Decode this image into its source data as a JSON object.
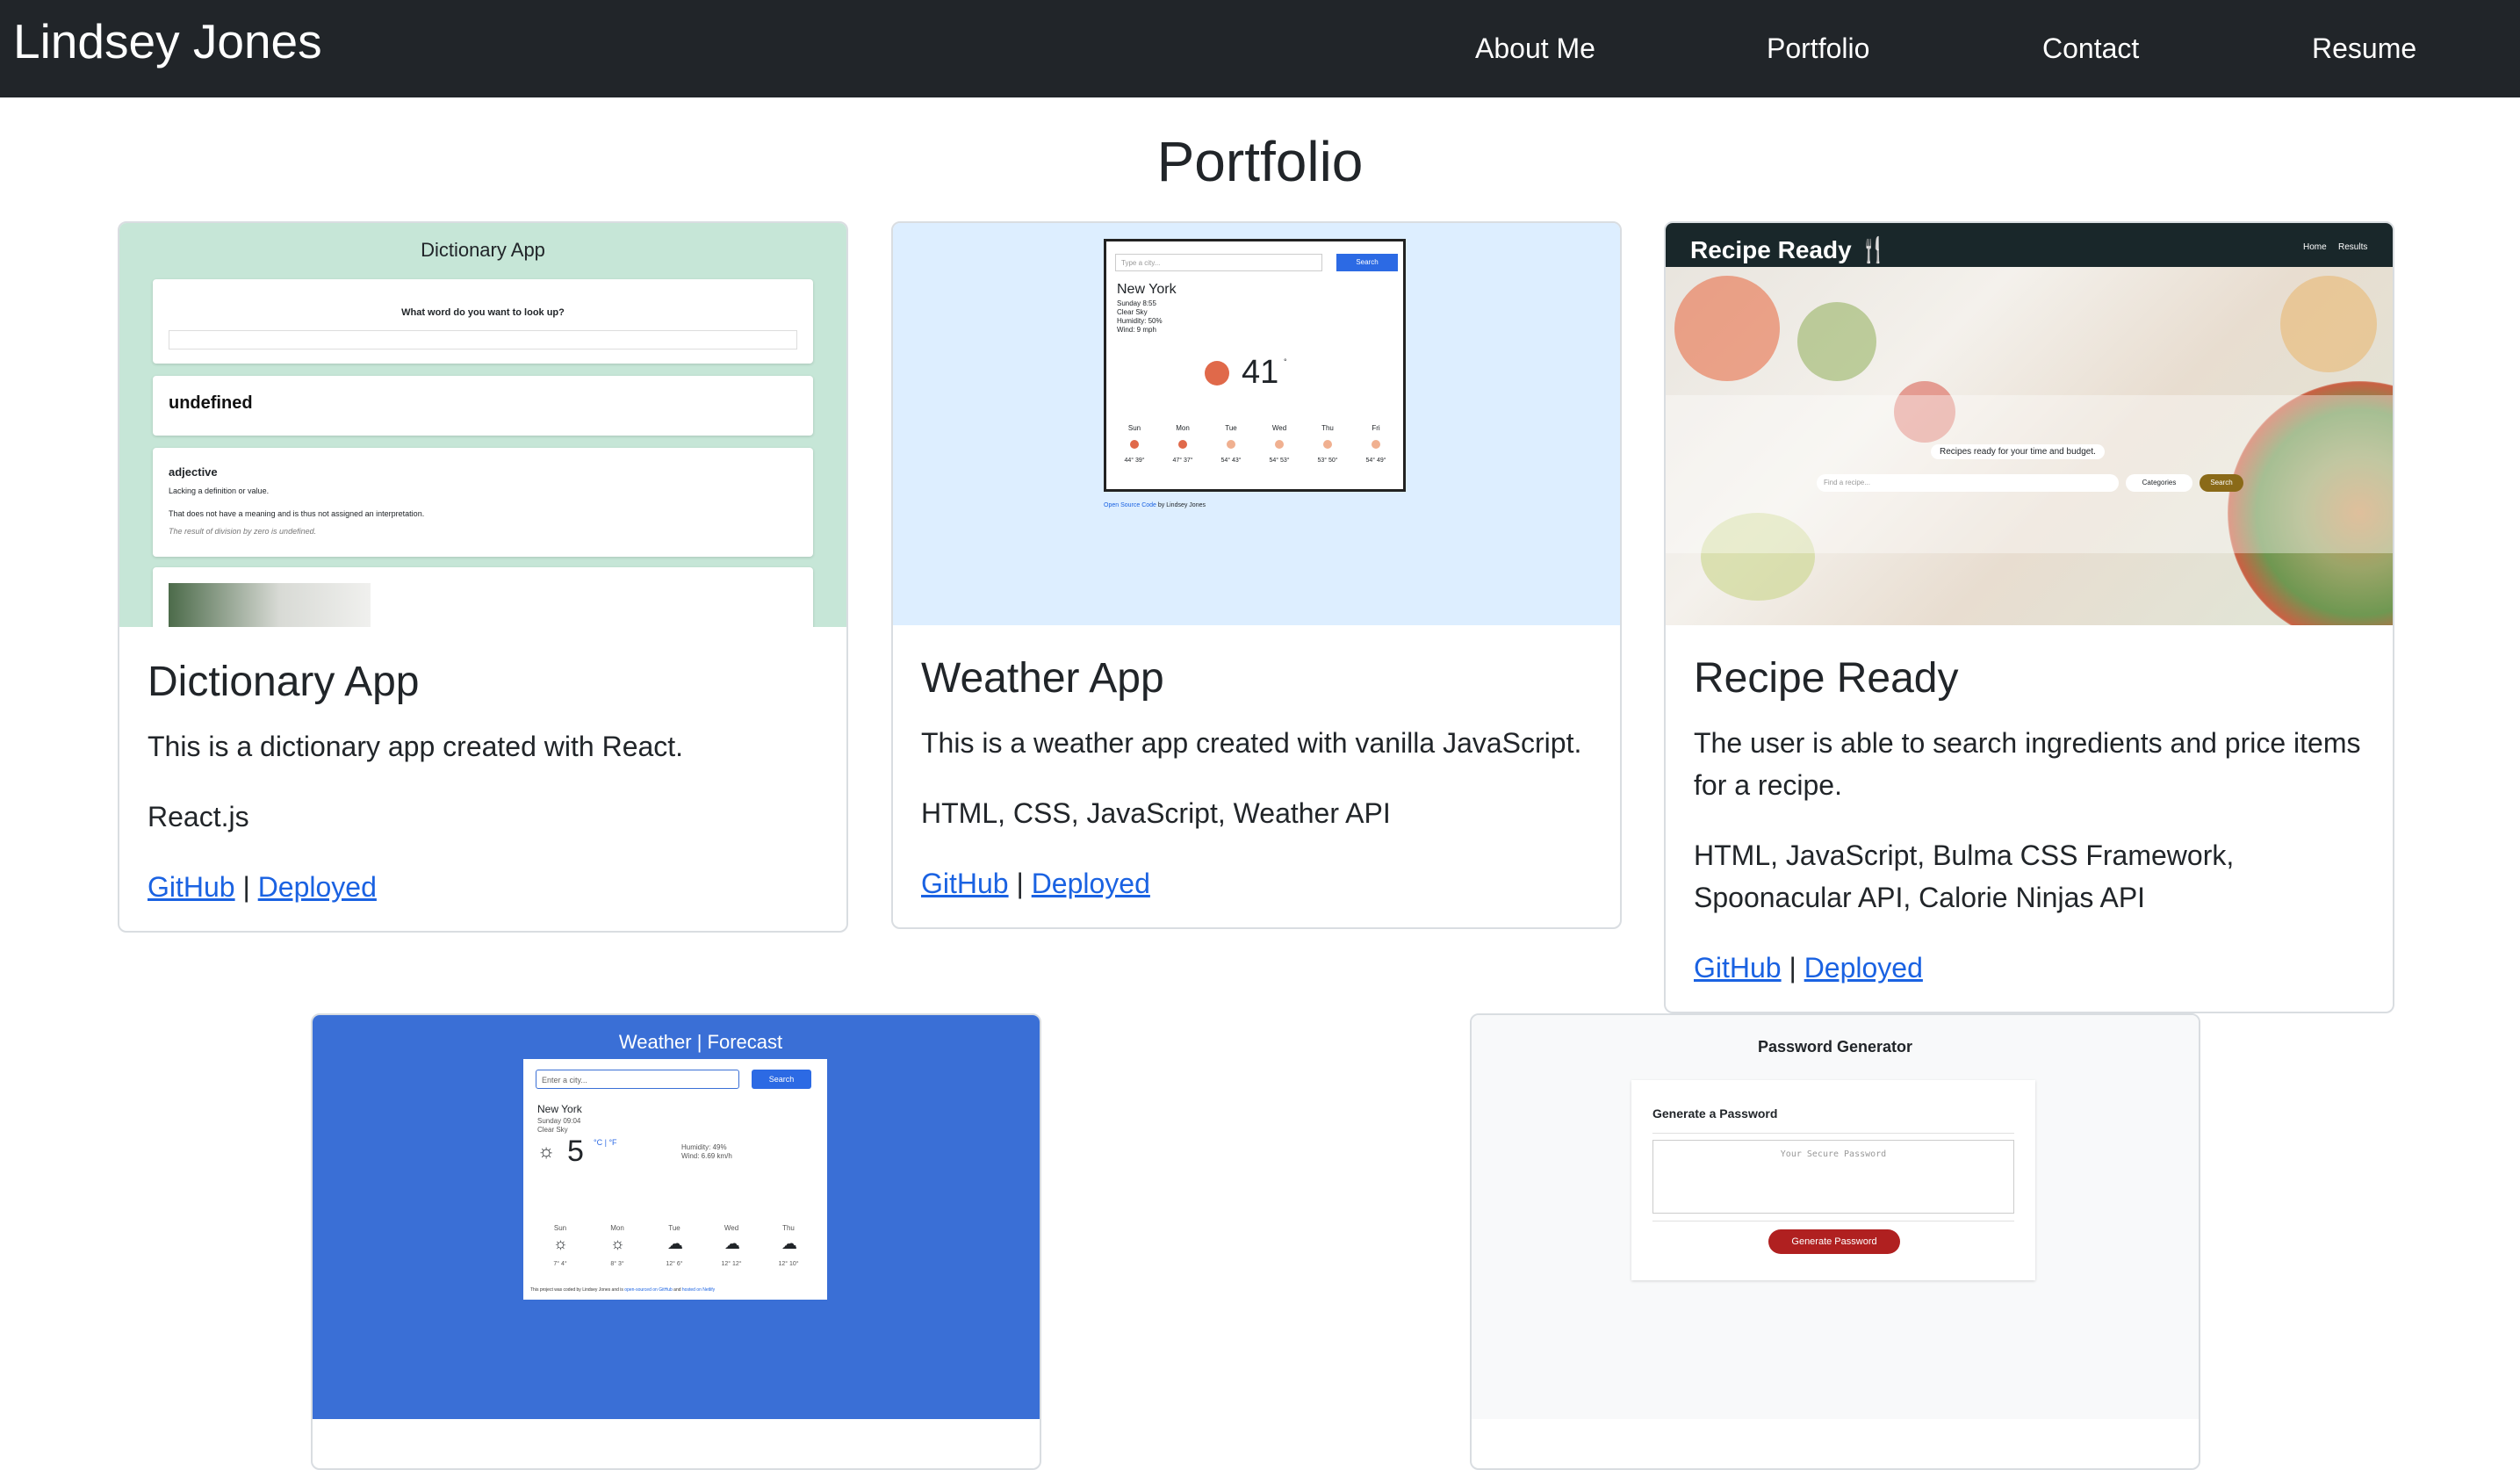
{
  "nav": {
    "brand": "Lindsey Jones",
    "links": [
      "About Me",
      "Portfolio",
      "Contact",
      "Resume"
    ]
  },
  "page": {
    "title": "Portfolio"
  },
  "projects": [
    {
      "title": "Dictionary App",
      "description": "This is a dictionary app created with React.",
      "tech": "React.js",
      "github": "GitHub",
      "separator": "|",
      "deployed": "Deployed",
      "screenshot": {
        "app_title": "Dictionary App",
        "prompt": "What word do you want to look up?",
        "word": "undefined",
        "part_of_speech": "adjective",
        "definition_1": "Lacking a definition or value.",
        "definition_2": "That does not have a meaning and is thus not assigned an interpretation.",
        "example": "The result of division by zero is undefined."
      }
    },
    {
      "title": "Weather App",
      "description": "This is a weather app created with vanilla JavaScript.",
      "tech": "HTML, CSS, JavaScript, Weather API",
      "github": "GitHub",
      "separator": "|",
      "deployed": "Deployed",
      "screenshot": {
        "placeholder": "Type a city...",
        "button": "Search",
        "city": "New York",
        "date": "Sunday 8:55",
        "condition": "Clear Sky",
        "humidity": "Humidity: 50%",
        "wind": "Wind: 9 mph",
        "temperature": "41",
        "degree": "°",
        "days": [
          "Sun",
          "Mon",
          "Tue",
          "Wed",
          "Thu",
          "Fri"
        ],
        "day_temps": [
          "44° 39°",
          "47° 37°",
          "54° 43°",
          "54° 53°",
          "53° 50°",
          "54° 49°"
        ],
        "footer_link": "Open Source Code",
        "footer_text": "by Lindsey Jones"
      }
    },
    {
      "title": "Recipe Ready",
      "description": "The user is able to search ingredients and price items for a recipe.",
      "tech": "HTML, JavaScript, Bulma CSS Framework, Spoonacular API, Calorie Ninjas API",
      "github": "GitHub",
      "separator": "|",
      "deployed": "Deployed",
      "screenshot": {
        "logo": "Recipe Ready 🍴",
        "menu": [
          "Home",
          "Results"
        ],
        "tagline": "Recipes ready for your time and budget.",
        "placeholder": "Find a recipe...",
        "categories": "Categories",
        "button": "Search"
      }
    },
    {
      "screenshot": {
        "app_title": "Weather | Forecast",
        "placeholder": "Enter a city...",
        "button": "Search",
        "city": "New York",
        "date": "Sunday 09:04",
        "condition": "Clear Sky",
        "temperature": "5",
        "units": "°C | °F",
        "humidity": "Humidity: 49%",
        "wind": "Wind: 6.69 km/h",
        "days": [
          "Sun",
          "Mon",
          "Tue",
          "Wed",
          "Thu"
        ],
        "day_temps": [
          "7° 4°",
          "8° 3°",
          "12° 6°",
          "12° 12°",
          "12° 10°"
        ],
        "credit_text": "This project was coded by Lindsey Jones and is",
        "credit_link_1": "open-sourced on GitHub",
        "credit_and": "and",
        "credit_link_2": "hosted on Netlify"
      }
    },
    {
      "screenshot": {
        "app_title": "Password Generator",
        "heading": "Generate a Password",
        "placeholder": "Your Secure Password",
        "button": "Generate Password"
      }
    }
  ]
}
